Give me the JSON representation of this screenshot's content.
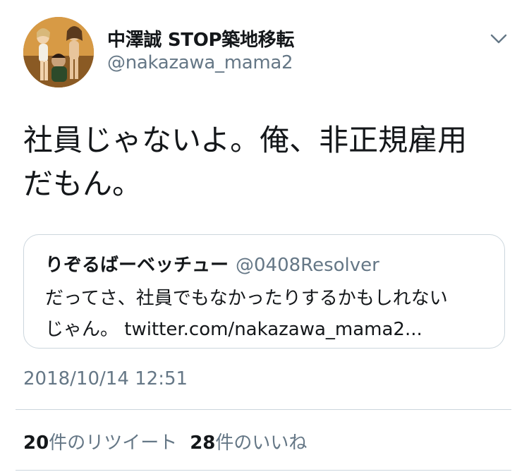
{
  "author": {
    "display_name": "中澤誠 STOP築地移転",
    "handle": "@nakazawa_mama2"
  },
  "tweet": {
    "text_lines": [
      "社員じゃないよ。俺、非正規雇用",
      "だもん。"
    ]
  },
  "quoted_tweet": {
    "display_name": "りぞるばーベッチュー",
    "handle": "@0408Resolver",
    "text_lines": [
      "だってさ、社員でもなかったりするかもしれない",
      "じゃん。 twitter.com/nakazawa_mama2..."
    ]
  },
  "timestamp": "2018/10/14 12:51",
  "stats": {
    "retweets": {
      "count": "20",
      "label": "件のリツイート"
    },
    "likes": {
      "count": "28",
      "label": "件のいいね"
    }
  },
  "icons": {
    "menu": "chevron-down-icon"
  },
  "colors": {
    "text_primary": "#14171a",
    "text_secondary": "#657786",
    "border": "#ccd6dd"
  }
}
